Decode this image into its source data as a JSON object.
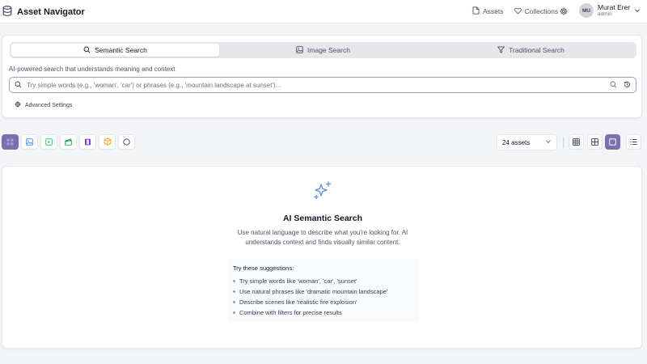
{
  "app": {
    "title": "Asset Navigator"
  },
  "nav": {
    "assets": "Assets",
    "collections": "Collections"
  },
  "user": {
    "initials": "MU",
    "name": "Murat Erer",
    "role": "admin"
  },
  "search": {
    "tabs": [
      {
        "label": "Semantic Search",
        "icon": "search-icon",
        "active": true
      },
      {
        "label": "Image Search",
        "icon": "image-icon",
        "active": false
      },
      {
        "label": "Traditional Search",
        "icon": "filter-icon",
        "active": false
      }
    ],
    "description": "AI-powered search that understands meaning and context",
    "placeholder": "Try simple words (e.g., 'woman', 'car') or phrases (e.g., 'mountain landscape at sunset')...",
    "value": "",
    "advanced_label": "Advanced Settings"
  },
  "toolbar": {
    "filters": [
      {
        "icon": "all-grid-icon",
        "active": true,
        "color": "#7c6fb0"
      },
      {
        "icon": "image-icon",
        "active": false,
        "color": "#3b82f6"
      },
      {
        "icon": "video-icon",
        "active": false,
        "color": "#22c55e"
      },
      {
        "icon": "clapperboard-icon",
        "active": false,
        "color": "#16a34a"
      },
      {
        "icon": "film-icon",
        "active": false,
        "color": "#7c3aed"
      },
      {
        "icon": "box-3d-icon",
        "active": false,
        "color": "#f59e0b"
      },
      {
        "icon": "circle-icon",
        "active": false,
        "color": "#374151"
      }
    ],
    "asset_count": "24 assets",
    "views": [
      {
        "icon": "dense-grid-icon",
        "active": false
      },
      {
        "icon": "grid-icon",
        "active": false
      },
      {
        "icon": "large-card-icon",
        "active": true
      },
      {
        "icon": "list-icon",
        "active": false
      }
    ]
  },
  "empty_state": {
    "title": "AI Semantic Search",
    "description": "Use natural language to describe what you're looking for. AI understands context and finds visually similar content.",
    "suggestions_title": "Try these suggestions:",
    "suggestions": [
      "Try simple words like 'woman', 'car', 'sunset'",
      "Use natural phrases like 'dramatic mountain landscape'",
      "Describe scenes like 'realistic fire explosion'",
      "Combine with filters for precise results"
    ]
  },
  "colors": {
    "accent": "#7c6fb0",
    "spark": "#5b8def"
  }
}
